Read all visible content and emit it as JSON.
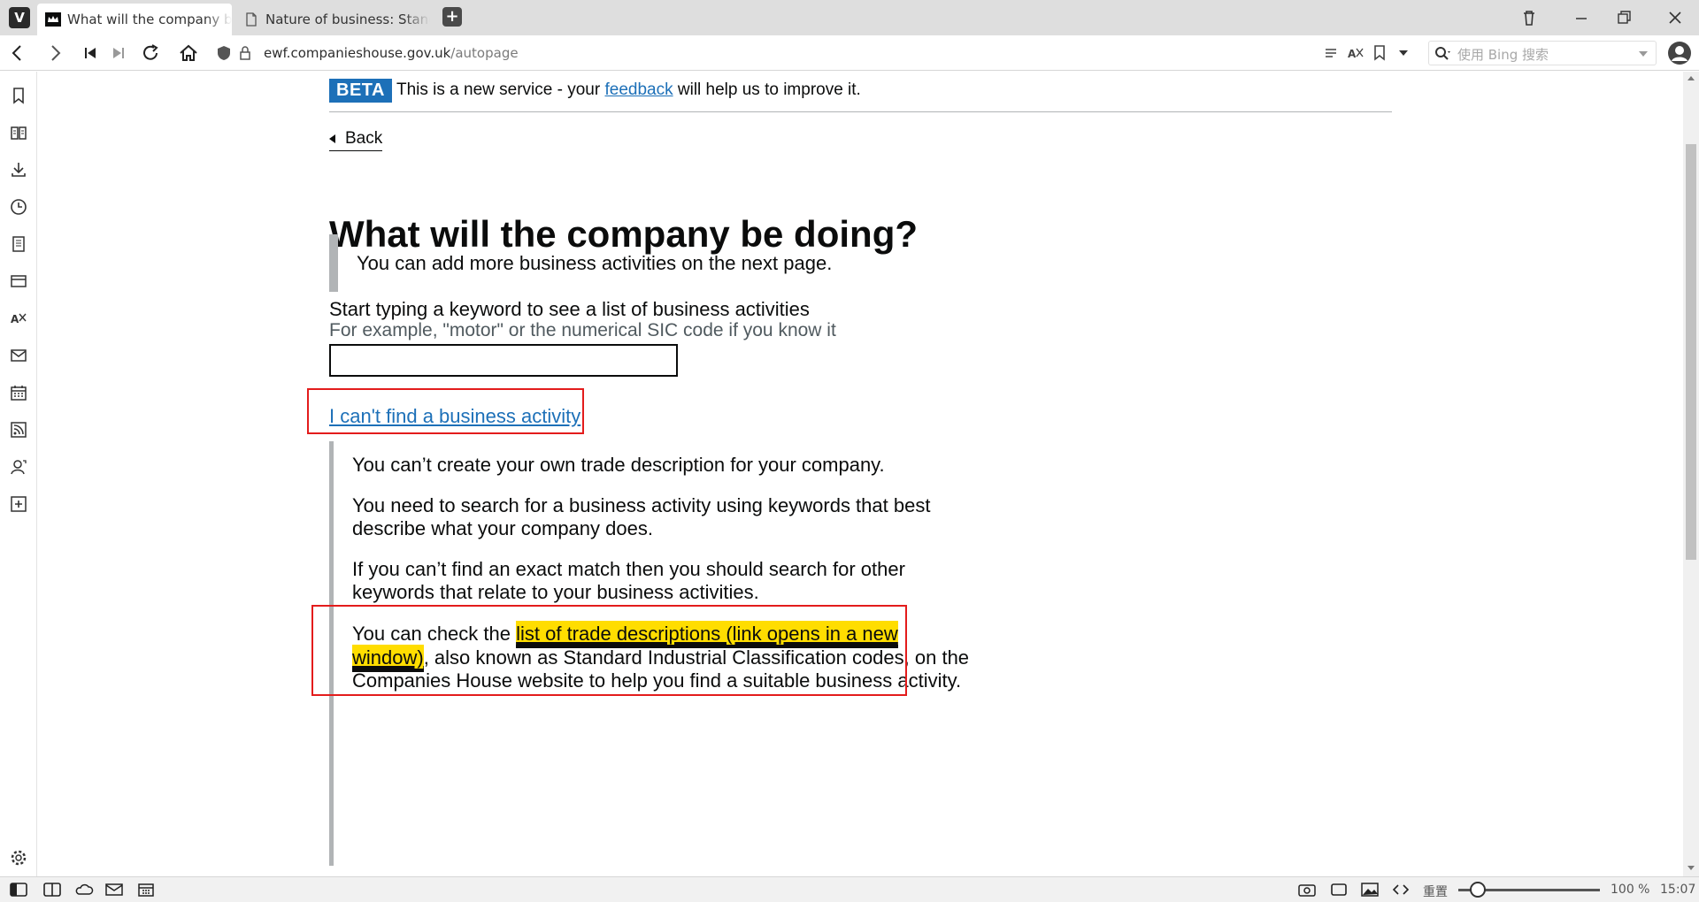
{
  "browser": {
    "logo": "V",
    "tabs": [
      {
        "title": "What will the company be doing?",
        "active": true
      },
      {
        "title": "Nature of business: Standard",
        "active": false
      }
    ],
    "new_tab": "+",
    "address": {
      "domain": "ewf.companieshouse.gov.uk",
      "path": "/autopage"
    },
    "search_placeholder": "使用 Bing 搜索",
    "status": {
      "reset_label": "重置",
      "zoom": "100 %",
      "time": "15:07",
      "zoom_level": 0.25
    }
  },
  "page": {
    "beta": {
      "tag": "BETA",
      "text_before": "This is a new service - your ",
      "link": "feedback",
      "text_after": " will help us to improve it."
    },
    "back_label": "Back",
    "title": "What will the company be doing?",
    "inset_text": "You can add more business activities on the next page.",
    "field_label": "Start typing a keyword to see a list of business activities",
    "field_hint": "For example, \"motor\" or the numerical SIC code if you know it",
    "field_value": "",
    "cant_find_link": "I can't find a business activity",
    "details": {
      "p1": "You can’t create your own trade description for your company.",
      "p2_line1": "You need to search for a business activity using keywords that best",
      "p2_line2": "describe what your company does.",
      "p3_line1": "If you can’t find an exact match then you should search for other",
      "p3_line2": "keywords that relate to your business activities.",
      "p4_prefix": "You can check the ",
      "p4_link_line1": "list of trade descriptions (link opens in a new",
      "p4_link_line2": "window)",
      "p4_suffix_line2": ", also known as Standard Industrial Classification codes, on the",
      "p4_line3": "Companies House website to help you find a suitable business activity."
    }
  },
  "colors": {
    "link": "#1d70b8",
    "beta_tag": "#1d70b8",
    "highlight": "#ffdd00",
    "annotation_box": "#e31c1c",
    "inset_border": "#b1b4b6"
  },
  "icons": {
    "sidepanel": [
      "bookmarks-icon",
      "reading-list-icon",
      "downloads-icon",
      "history-icon",
      "notes-icon",
      "window-panel-icon",
      "translate-icon",
      "mail-icon",
      "calendar-icon",
      "feeds-icon",
      "contacts-icon",
      "add-panel-icon",
      "settings-icon"
    ],
    "statusbar": [
      "panel-toggle-icon",
      "tab-tiling-icon",
      "sync-icon",
      "mail-status-icon",
      "calendar-status-icon",
      "capture-icon",
      "window-icon",
      "image-icon",
      "code-icon"
    ]
  }
}
